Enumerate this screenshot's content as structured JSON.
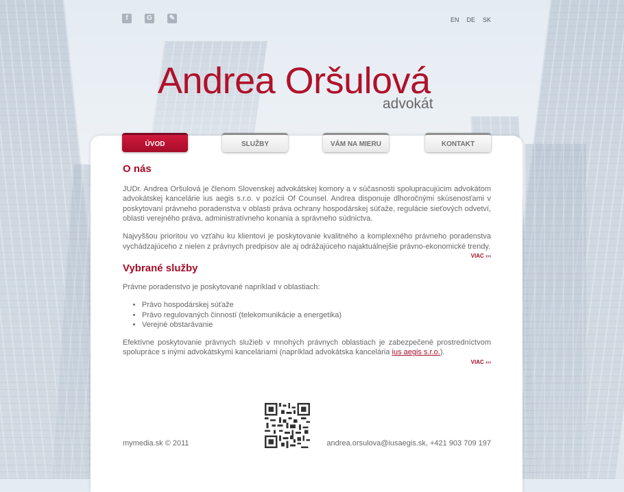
{
  "social": {
    "facebook_icon": "facebook-icon",
    "google_icon": "google-plus-icon",
    "share_icon": "share-icon"
  },
  "languages": [
    "EN",
    "DE",
    "SK"
  ],
  "logo": {
    "name": "Andrea Oršulová",
    "subtitle": "advokát"
  },
  "tabs": [
    {
      "label": "ÚVOD",
      "active": true
    },
    {
      "label": "SLUŽBY",
      "active": false
    },
    {
      "label": "VÁM NA MIERU",
      "active": false
    },
    {
      "label": "KONTAKT",
      "active": false
    }
  ],
  "about": {
    "heading": "O nás",
    "p1": "JUDr. Andrea Oršulová je členom Slovenskej advokátskej komory a v súčasnosti spolupracujúcim advokátom advokátskej kancelárie ius aegis s.r.o. v pozícii Of Counsel. Andrea disponuje dlhoročnými skúsenosťami v poskytovaní právneho poradenstva v oblasti práva ochrany hospodárskej súťaže, regulácie sieťových odvetví, oblasti verejného práva, administratívneho konania a správneho súdnictva.",
    "p2": "Najvyššou prioritou vo vzťahu ku klientovi je poskytovanie kvalitného a komplexného právneho poradenstva vychádzajúceho z nielen z právnych predpisov ale aj odrážajúceho najaktuálnejšie právno-ekonomické trendy.",
    "more": "VIAC ›››"
  },
  "services": {
    "heading": "Vybrané služby",
    "intro": "Právne poradenstvo je poskytované napríklad v oblastiach:",
    "items": [
      "Právo hospodárskej súťaže",
      "Právo regulovaných činností (telekomunikácie a energetika)",
      "Verejné obstarávanie"
    ],
    "p_before": "Efektívne poskytovanie právnych služieb v mnohých právnych oblastiach je zabezpečené prostredníctvom spolupráce s inými advokátskymi kanceláriami (napríklad advokátska kancelária ",
    "link": "ius aegis s.r.o.",
    "p_after": ").",
    "more": "VIAC ›››"
  },
  "footer": {
    "left": "mymedia.sk © 2011",
    "right": "andrea.orsulova@iusaegis.sk, +421 903 709 197",
    "qr_icon": "qr-code-icon"
  },
  "colors": {
    "accent": "#a50d29",
    "logo": "#b0112b"
  }
}
